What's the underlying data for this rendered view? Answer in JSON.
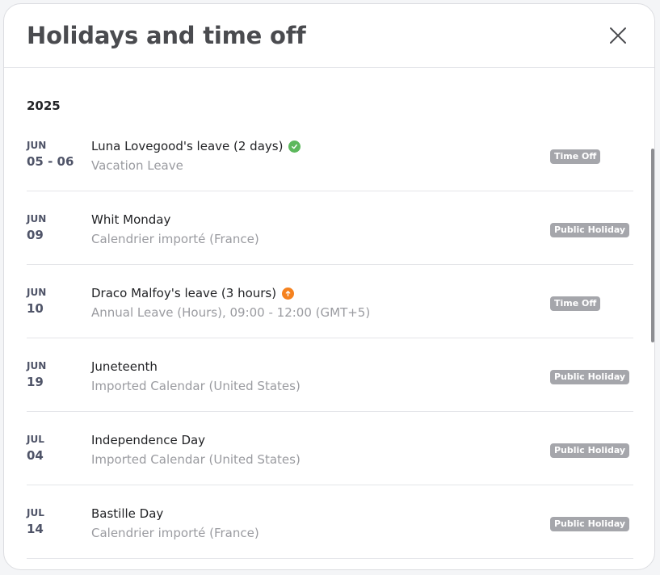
{
  "dialog": {
    "title": "Holidays and time off",
    "year": "2025"
  },
  "events": [
    {
      "month": "JUN",
      "day": "05 - 06",
      "name": "Luna Lovegood's leave (2 days)",
      "subtitle": "Vacation Leave",
      "badge": "Time Off",
      "status_icon": "approved-check-icon",
      "status_color": "#5cb85c"
    },
    {
      "month": "JUN",
      "day": "09",
      "name": "Whit Monday",
      "subtitle": "Calendrier importé (France)",
      "badge": "Public Holiday"
    },
    {
      "month": "JUN",
      "day": "10",
      "name": "Draco Malfoy's leave (3 hours)",
      "subtitle": "Annual Leave (Hours), 09:00 - 12:00 (GMT+5)",
      "badge": "Time Off",
      "status_icon": "pending-arrow-icon",
      "status_color": "#f5821f"
    },
    {
      "month": "JUN",
      "day": "19",
      "name": "Juneteenth",
      "subtitle": "Imported Calendar (United States)",
      "badge": "Public Holiday"
    },
    {
      "month": "JUL",
      "day": "04",
      "name": "Independence Day",
      "subtitle": "Imported Calendar (United States)",
      "badge": "Public Holiday"
    },
    {
      "month": "JUL",
      "day": "14",
      "name": "Bastille Day",
      "subtitle": "Calendrier importé (France)",
      "badge": "Public Holiday"
    }
  ],
  "colors": {
    "badge_background": "#a5a6ab",
    "date_text": "#4f5468"
  }
}
